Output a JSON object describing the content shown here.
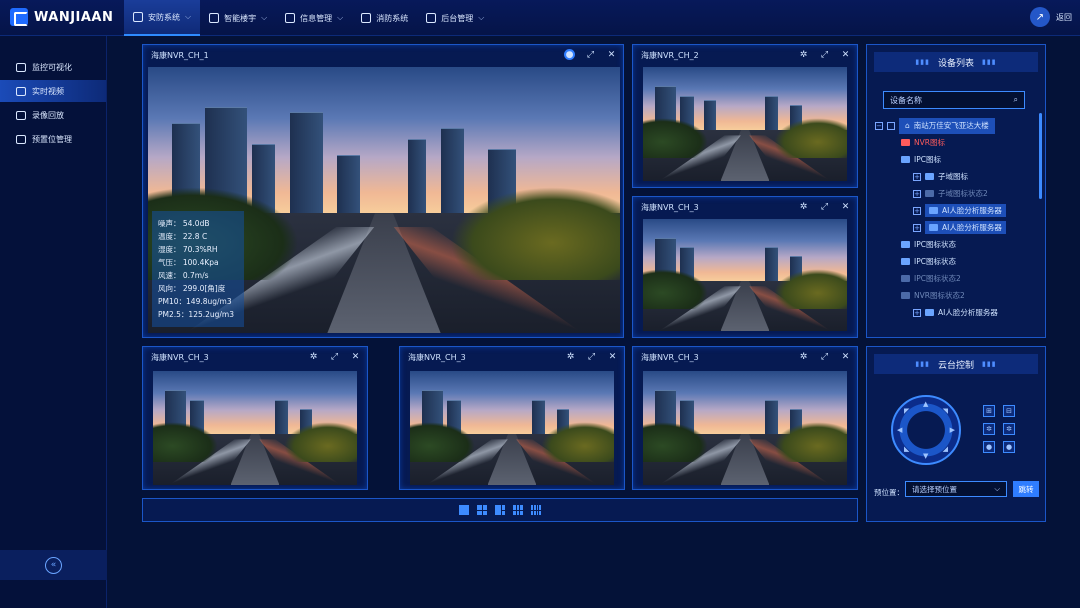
{
  "brand": {
    "name": "WANJIAAN"
  },
  "nav": [
    {
      "label": "安防系统",
      "active": true
    },
    {
      "label": "智能楼宇",
      "active": false
    },
    {
      "label": "信息管理",
      "active": false
    },
    {
      "label": "消防系统",
      "active": false
    },
    {
      "label": "后台管理",
      "active": false
    }
  ],
  "header": {
    "back_label": "返回"
  },
  "sidebar": {
    "items": [
      {
        "label": "监控可视化",
        "active": false
      },
      {
        "label": "实时视频",
        "active": true
      },
      {
        "label": "录像回放",
        "active": false
      },
      {
        "label": "预置位管理",
        "active": false
      }
    ]
  },
  "video": {
    "main": {
      "title": "海康NVR_CH_1"
    },
    "ch2": {
      "title": "海康NVR_CH_2"
    },
    "ch3a": {
      "title": "海康NVR_CH_3"
    },
    "ch3b": {
      "title": "海康NVR_CH_3"
    },
    "ch3c": {
      "title": "海康NVR_CH_3"
    },
    "ch3d": {
      "title": "海康NVR_CH_3"
    }
  },
  "stats": [
    "噪声： 54.0dB",
    "温度： 22.8 C",
    "湿度： 70.3%RH",
    "气压： 100.4Kpa",
    "风速： 0.7m/s",
    "风向： 299.0[角]度",
    "PM10：149.8ug/m3",
    "PM2.5：125.2ug/m3"
  ],
  "device_list": {
    "title": "设备列表",
    "search_placeholder": "设备名称",
    "tree": [
      {
        "label": "南站万佳安飞亚达大楼",
        "level": 0,
        "selected": true
      },
      {
        "label": "NVR图标",
        "level": 1,
        "red": true
      },
      {
        "label": "IPC图标",
        "level": 1
      },
      {
        "label": "子域图标",
        "level": 2
      },
      {
        "label": "子域图标状态2",
        "level": 2,
        "dim": true
      },
      {
        "label": "AI人脸分析服务器",
        "level": 2,
        "selected": true
      },
      {
        "label": "AI人脸分析服务器",
        "level": 2,
        "selected": true
      },
      {
        "label": "IPC图标状态",
        "level": 1
      },
      {
        "label": "IPC图标状态",
        "level": 1
      },
      {
        "label": "IPC图标状态2",
        "level": 1,
        "dim": true
      },
      {
        "label": "NVR图标状态2",
        "level": 1,
        "dim": true
      },
      {
        "label": "AI人脸分析服务器",
        "level": 2
      }
    ]
  },
  "ptz": {
    "title": "云台控制",
    "preset_label": "预位置：",
    "preset_placeholder": "请选择预位置",
    "jump_label": "跳转"
  }
}
